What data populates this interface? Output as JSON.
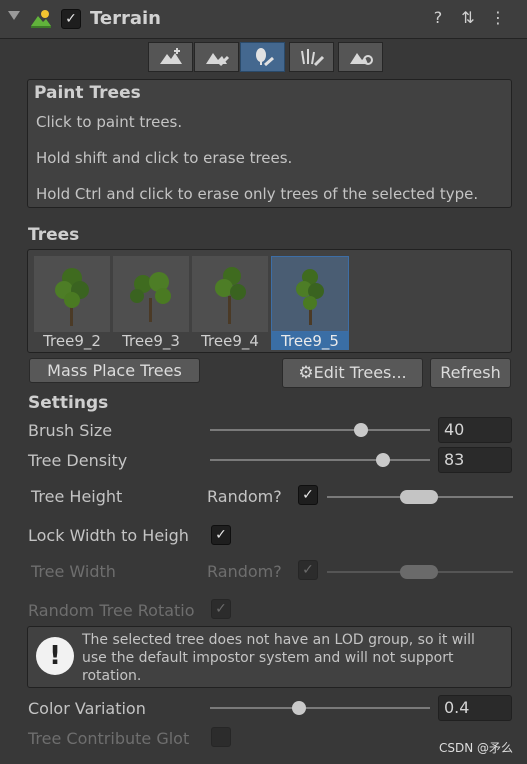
{
  "header": {
    "title": "Terrain",
    "enabled": "✓",
    "help_icon": "?",
    "presets_icon": "⇅",
    "menu_icon": "⋮"
  },
  "toolbar": {
    "tools": [
      "raise-lower-terrain-icon",
      "paint-texture-icon",
      "paint-trees-icon",
      "paint-details-icon",
      "terrain-settings-icon"
    ],
    "active_index": 2
  },
  "help": {
    "title": "Paint Trees",
    "line1": "Click to paint trees.",
    "line2": "Hold shift and click to erase trees.",
    "line3": "Hold Ctrl and click to erase only trees of the selected type."
  },
  "trees": {
    "heading": "Trees",
    "items": [
      {
        "label": "Tree9_2",
        "selected": false
      },
      {
        "label": "Tree9_3",
        "selected": false
      },
      {
        "label": "Tree9_4",
        "selected": false
      },
      {
        "label": "Tree9_5",
        "selected": true
      }
    ],
    "mass_place_label": "Mass Place Trees",
    "edit_trees_label": "Edit Trees...",
    "refresh_label": "Refresh"
  },
  "settings": {
    "heading": "Settings",
    "brush_size": {
      "label": "Brush Size",
      "value": "40",
      "fraction": 0.69
    },
    "tree_density": {
      "label": "Tree Density",
      "value": "83",
      "fraction": 0.83
    },
    "tree_height": {
      "label": "Tree Height",
      "random_label": "Random?",
      "checked": "✓"
    },
    "lock_width": {
      "label": "Lock Width to Heigh",
      "checked": "✓"
    },
    "tree_width": {
      "label": "Tree Width",
      "random_label": "Random?",
      "checked": "✓"
    },
    "random_rotation": {
      "label": "Random Tree Rotatio",
      "checked": "✓"
    },
    "warning": "The selected tree does not have an LOD group, so it will\nuse the default impostor system and will not support\nrotation.",
    "color_variation": {
      "label": "Color Variation",
      "value": "0.4",
      "fraction": 0.4
    },
    "contribute_gi": {
      "label": "Tree Contribute Glot",
      "checked": ""
    }
  },
  "watermark": "CSDN @矛么"
}
